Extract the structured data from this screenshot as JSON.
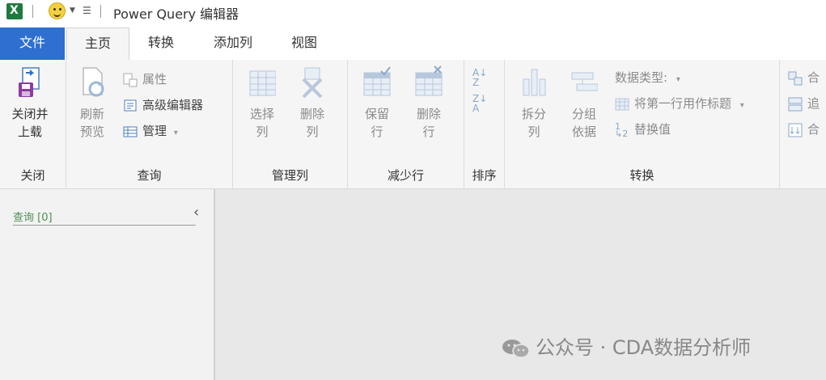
{
  "window": {
    "title": "Power Query 编辑器"
  },
  "tabs": [
    "文件",
    "主页",
    "转换",
    "添加列",
    "视图"
  ],
  "ribbon": {
    "close": {
      "button": "关闭并上载",
      "group": "关闭"
    },
    "query": {
      "refresh": "刷新预览",
      "properties": "属性",
      "advanced_editor": "高级编辑器",
      "manage": "管理",
      "group": "查询"
    },
    "manage_columns": {
      "choose": "选择列",
      "remove": "删除列",
      "group": "管理列"
    },
    "reduce_rows": {
      "keep": "保留行",
      "remove": "删除行",
      "group": "减少行"
    },
    "sort": {
      "group": "排序"
    },
    "transform": {
      "split": "拆分列",
      "group_by": "分组依据",
      "data_type": "数据类型:",
      "use_first_row": "将第一行用作标题",
      "replace": "替换值",
      "group": "转换"
    },
    "combine": {
      "merge": "合",
      "append": "追",
      "combine_files": "合"
    }
  },
  "queries_pane": {
    "label": "查询 [0]"
  },
  "watermark": "公众号 · CDA数据分析师",
  "colors": {
    "file_tab": "#2e6fcf",
    "excel_green": "#1f7a3d",
    "queries_label": "#4f8f52"
  }
}
